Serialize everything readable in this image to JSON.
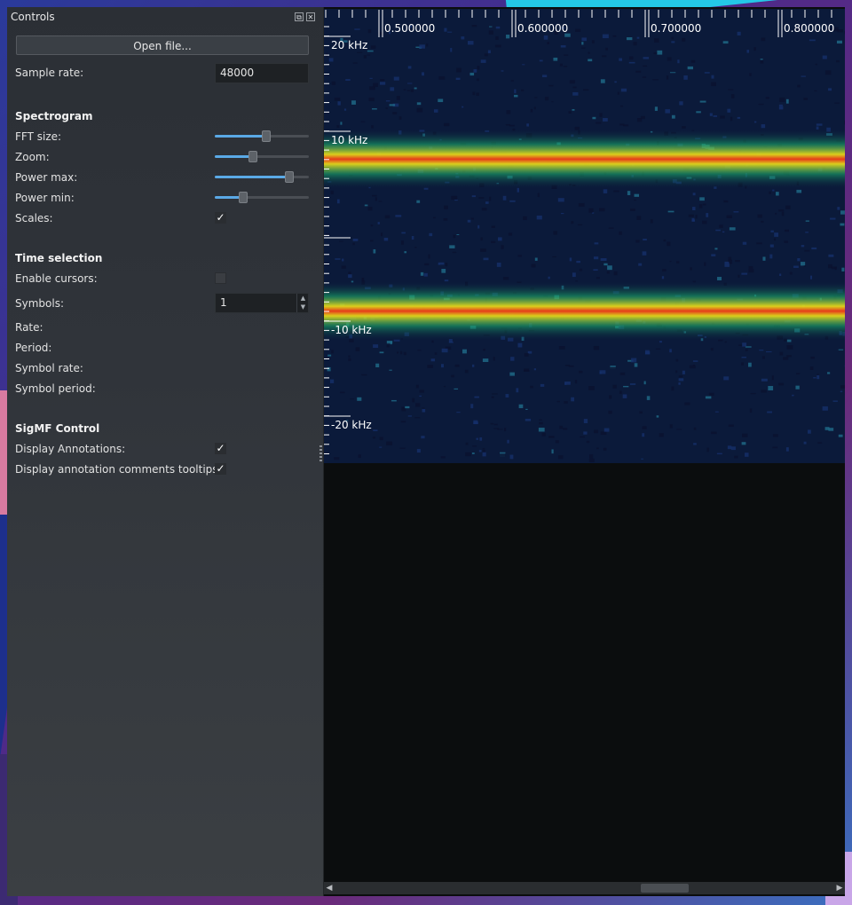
{
  "dock": {
    "title": "Controls",
    "open_file_label": "Open file...",
    "sample_rate": {
      "label": "Sample rate:",
      "value": "48000"
    },
    "spectrogram": {
      "header": "Spectrogram",
      "fft_size": {
        "label": "FFT size:",
        "level": 0.55
      },
      "zoom": {
        "label": "Zoom:",
        "level": 0.41
      },
      "power_max": {
        "label": "Power max:",
        "level": 0.79
      },
      "power_min": {
        "label": "Power min:",
        "level": 0.3
      },
      "scales": {
        "label": "Scales:",
        "checked": true,
        "mark": "✓"
      }
    },
    "time_selection": {
      "header": "Time selection",
      "enable_cursors": {
        "label": "Enable cursors:",
        "checked": false
      },
      "symbols": {
        "label": "Symbols:",
        "value": "1"
      },
      "rate": {
        "label": "Rate:"
      },
      "period": {
        "label": "Period:"
      },
      "symbol_rate": {
        "label": "Symbol rate:"
      },
      "symbol_period": {
        "label": "Symbol period:"
      }
    },
    "sigmf": {
      "header": "SigMF Control",
      "display_annotations": {
        "label": "Display Annotations:",
        "checked": true,
        "mark": "✓"
      },
      "display_tooltips": {
        "label": "Display annotation comments tooltips:",
        "checked": true,
        "mark": "✓"
      }
    }
  },
  "spectrogram_view": {
    "time_ticks": [
      "0.500000",
      "0.600000",
      "0.700000",
      "0.800000"
    ],
    "freq_ticks": [
      "20 kHz",
      "10 kHz",
      "-10 kHz",
      "-20 kHz"
    ],
    "signal_tones_khz": [
      8,
      -8
    ],
    "colors": {
      "background": "#0b1a3a",
      "signal_peak": "#e63a1a",
      "signal_mid": "#e6d81a",
      "signal_edge": "#1aa86a"
    }
  },
  "scrollbar": {
    "left_arrow": "◀",
    "right_arrow": "▶",
    "position": 0.68
  }
}
